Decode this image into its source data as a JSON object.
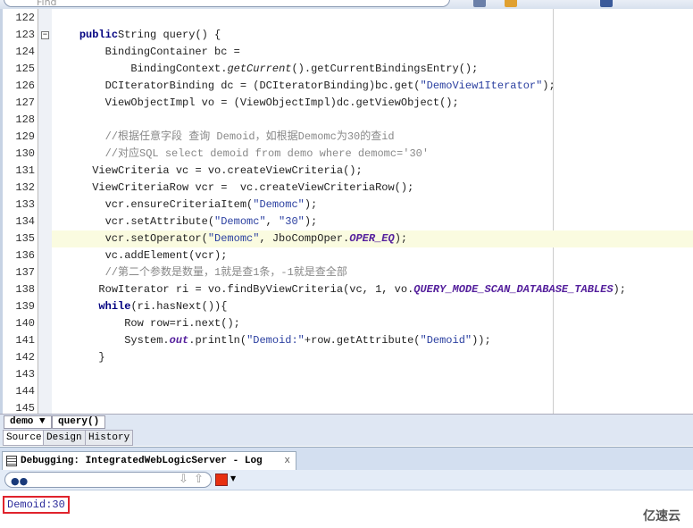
{
  "toolbar": {
    "find_placeholder": "Find"
  },
  "editor": {
    "lines": [
      {
        "n": "122",
        "i": 0,
        "s": []
      },
      {
        "n": "123",
        "i": 4,
        "fold": true,
        "s": [
          [
            "kw",
            "public"
          ],
          [
            "",
            "String query() {"
          ]
        ]
      },
      {
        "n": "124",
        "i": 8,
        "s": [
          [
            "",
            "BindingContainer bc ="
          ]
        ]
      },
      {
        "n": "125",
        "i": 12,
        "s": [
          [
            "",
            "BindingContext."
          ],
          [
            "it",
            "getCurrent"
          ],
          [
            "",
            "().getCurrentBindingsEntry();"
          ]
        ]
      },
      {
        "n": "126",
        "i": 8,
        "s": [
          [
            "",
            "DCIteratorBinding dc = (DCIteratorBinding)bc.get("
          ],
          [
            "str",
            "\"DemoView1Iterator\""
          ],
          [
            "",
            ");"
          ]
        ]
      },
      {
        "n": "127",
        "i": 8,
        "s": [
          [
            "",
            "ViewObjectImpl vo = (ViewObjectImpl)dc.getViewObject();"
          ]
        ]
      },
      {
        "n": "128",
        "i": 0,
        "s": []
      },
      {
        "n": "129",
        "i": 8,
        "s": [
          [
            "cm",
            "//根据任意字段 查询 Demoid，如根据Demomc为30的查id"
          ]
        ]
      },
      {
        "n": "130",
        "i": 8,
        "s": [
          [
            "cm",
            "//对应SQL select demoid from demo where demomc='30'"
          ]
        ]
      },
      {
        "n": "131",
        "i": 6,
        "s": [
          [
            "",
            "ViewCriteria vc = vo.createViewCriteria();"
          ]
        ]
      },
      {
        "n": "132",
        "i": 6,
        "s": [
          [
            "",
            "ViewCriteriaRow vcr =  vc.createViewCriteriaRow();"
          ]
        ]
      },
      {
        "n": "133",
        "i": 8,
        "s": [
          [
            "",
            "vcr.ensureCriteriaItem("
          ],
          [
            "str",
            "\"Demomc\""
          ],
          [
            "",
            ");"
          ]
        ]
      },
      {
        "n": "134",
        "i": 8,
        "s": [
          [
            "",
            "vcr.setAttribute("
          ],
          [
            "str",
            "\"Demomc\""
          ],
          [
            "",
            ", "
          ],
          [
            "str",
            "\"30\""
          ],
          [
            "",
            ");"
          ]
        ]
      },
      {
        "n": "135",
        "i": 8,
        "hl": true,
        "s": [
          [
            "",
            "vcr.setOperator("
          ],
          [
            "str",
            "\"Demomc\""
          ],
          [
            "",
            ", JboCompOper."
          ],
          [
            "const",
            "OPER_EQ"
          ],
          [
            "",
            ");"
          ]
        ]
      },
      {
        "n": "136",
        "i": 8,
        "s": [
          [
            "",
            "vc.addElement(vcr);"
          ]
        ]
      },
      {
        "n": "137",
        "i": 8,
        "s": [
          [
            "cm",
            "//第二个参数是数量，1就是查1条，-1就是查全部"
          ]
        ]
      },
      {
        "n": "138",
        "i": 7,
        "s": [
          [
            "",
            "RowIterator ri = vo.findByViewCriteria(vc, 1, vo."
          ],
          [
            "const",
            "QUERY_MODE_SCAN_DATABASE_TABLES"
          ],
          [
            "",
            ");"
          ]
        ]
      },
      {
        "n": "139",
        "i": 7,
        "s": [
          [
            "kw",
            "while"
          ],
          [
            "",
            "(ri.hasNext()){"
          ]
        ]
      },
      {
        "n": "140",
        "i": 11,
        "s": [
          [
            "",
            "Row row=ri.next();"
          ]
        ]
      },
      {
        "n": "141",
        "i": 11,
        "s": [
          [
            "",
            "System."
          ],
          [
            "const",
            "out"
          ],
          [
            "",
            ".println("
          ],
          [
            "str",
            "\"Demoid:\""
          ],
          [
            "",
            "+row.getAttribute("
          ],
          [
            "str",
            "\"Demoid\""
          ],
          [
            "",
            "));"
          ]
        ]
      },
      {
        "n": "142",
        "i": 7,
        "s": [
          [
            "",
            "}"
          ]
        ]
      },
      {
        "n": "143",
        "i": 0,
        "s": []
      },
      {
        "n": "144",
        "i": 0,
        "s": []
      },
      {
        "n": "145",
        "i": 0,
        "s": []
      }
    ]
  },
  "breadcrumb": {
    "class": "demo ▼",
    "method": "query()"
  },
  "tabs": [
    {
      "label": "Source",
      "active": true
    },
    {
      "label": "Design"
    },
    {
      "label": "History"
    }
  ],
  "log": {
    "title": "Debugging: IntegratedWebLogicServer - Log",
    "close": "x",
    "output": "Demoid:30"
  },
  "watermark": "亿速云",
  "colors": {
    "highlight": "#fafbe0",
    "output_border": "#e0232c",
    "stop": "#e83010"
  }
}
